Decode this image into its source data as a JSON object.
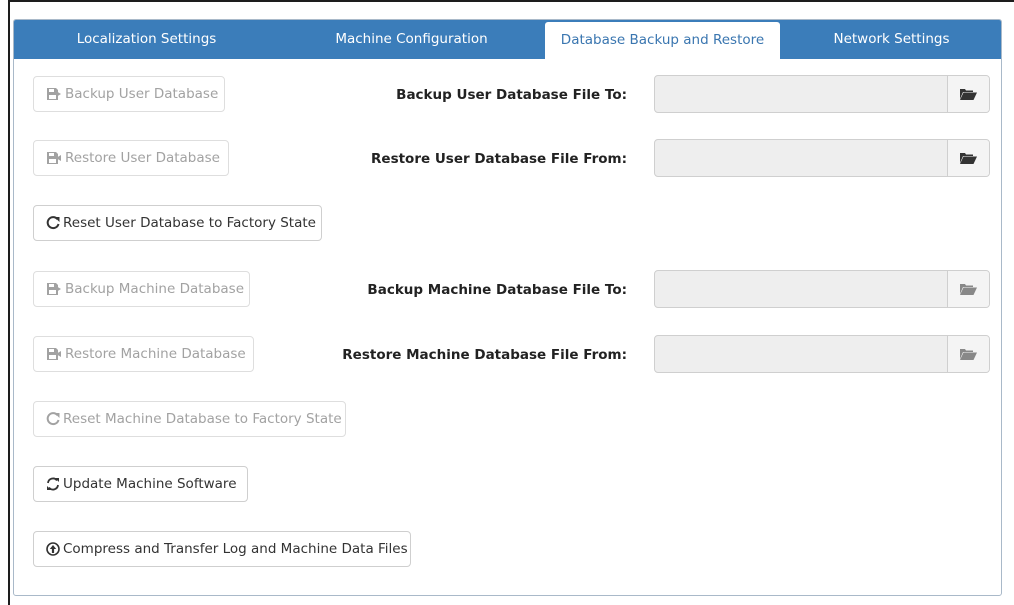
{
  "tabs": [
    {
      "label": "Localization Settings"
    },
    {
      "label": "Machine Configuration"
    },
    {
      "label": "Database Backup and Restore"
    },
    {
      "label": "Network Settings"
    }
  ],
  "active_tab": "Database Backup and Restore",
  "buttons": {
    "backup_user": "Backup User Database",
    "restore_user": "Restore User Database",
    "reset_user": "Reset User Database to Factory State",
    "backup_machine": "Backup Machine Database",
    "restore_machine": "Restore Machine Database",
    "reset_machine": "Reset Machine Database to Factory State",
    "update_software": "Update Machine Software",
    "compress_transfer": "Compress and Transfer Log and Machine Data Files"
  },
  "labels": {
    "backup_user_to": "Backup User Database File To:",
    "restore_user_from": "Restore User Database File From:",
    "backup_machine_to": "Backup Machine Database File To:",
    "restore_machine_from": "Restore Machine Database File From:"
  },
  "fields": {
    "backup_user_path": "",
    "restore_user_path": "",
    "backup_machine_path": "",
    "restore_machine_path": ""
  },
  "icons": {
    "backup": "save-export-icon",
    "restore": "save-import-icon",
    "reset": "refresh-icon",
    "update": "sync-icon",
    "upload": "circle-arrow-up-icon",
    "browse": "folder-open-icon"
  },
  "colors": {
    "tab_bar": "#3b7dba",
    "active_tab_text": "#3a76b0",
    "disabled_text": "#a2a2a2",
    "field_bg": "#eeeeee"
  }
}
